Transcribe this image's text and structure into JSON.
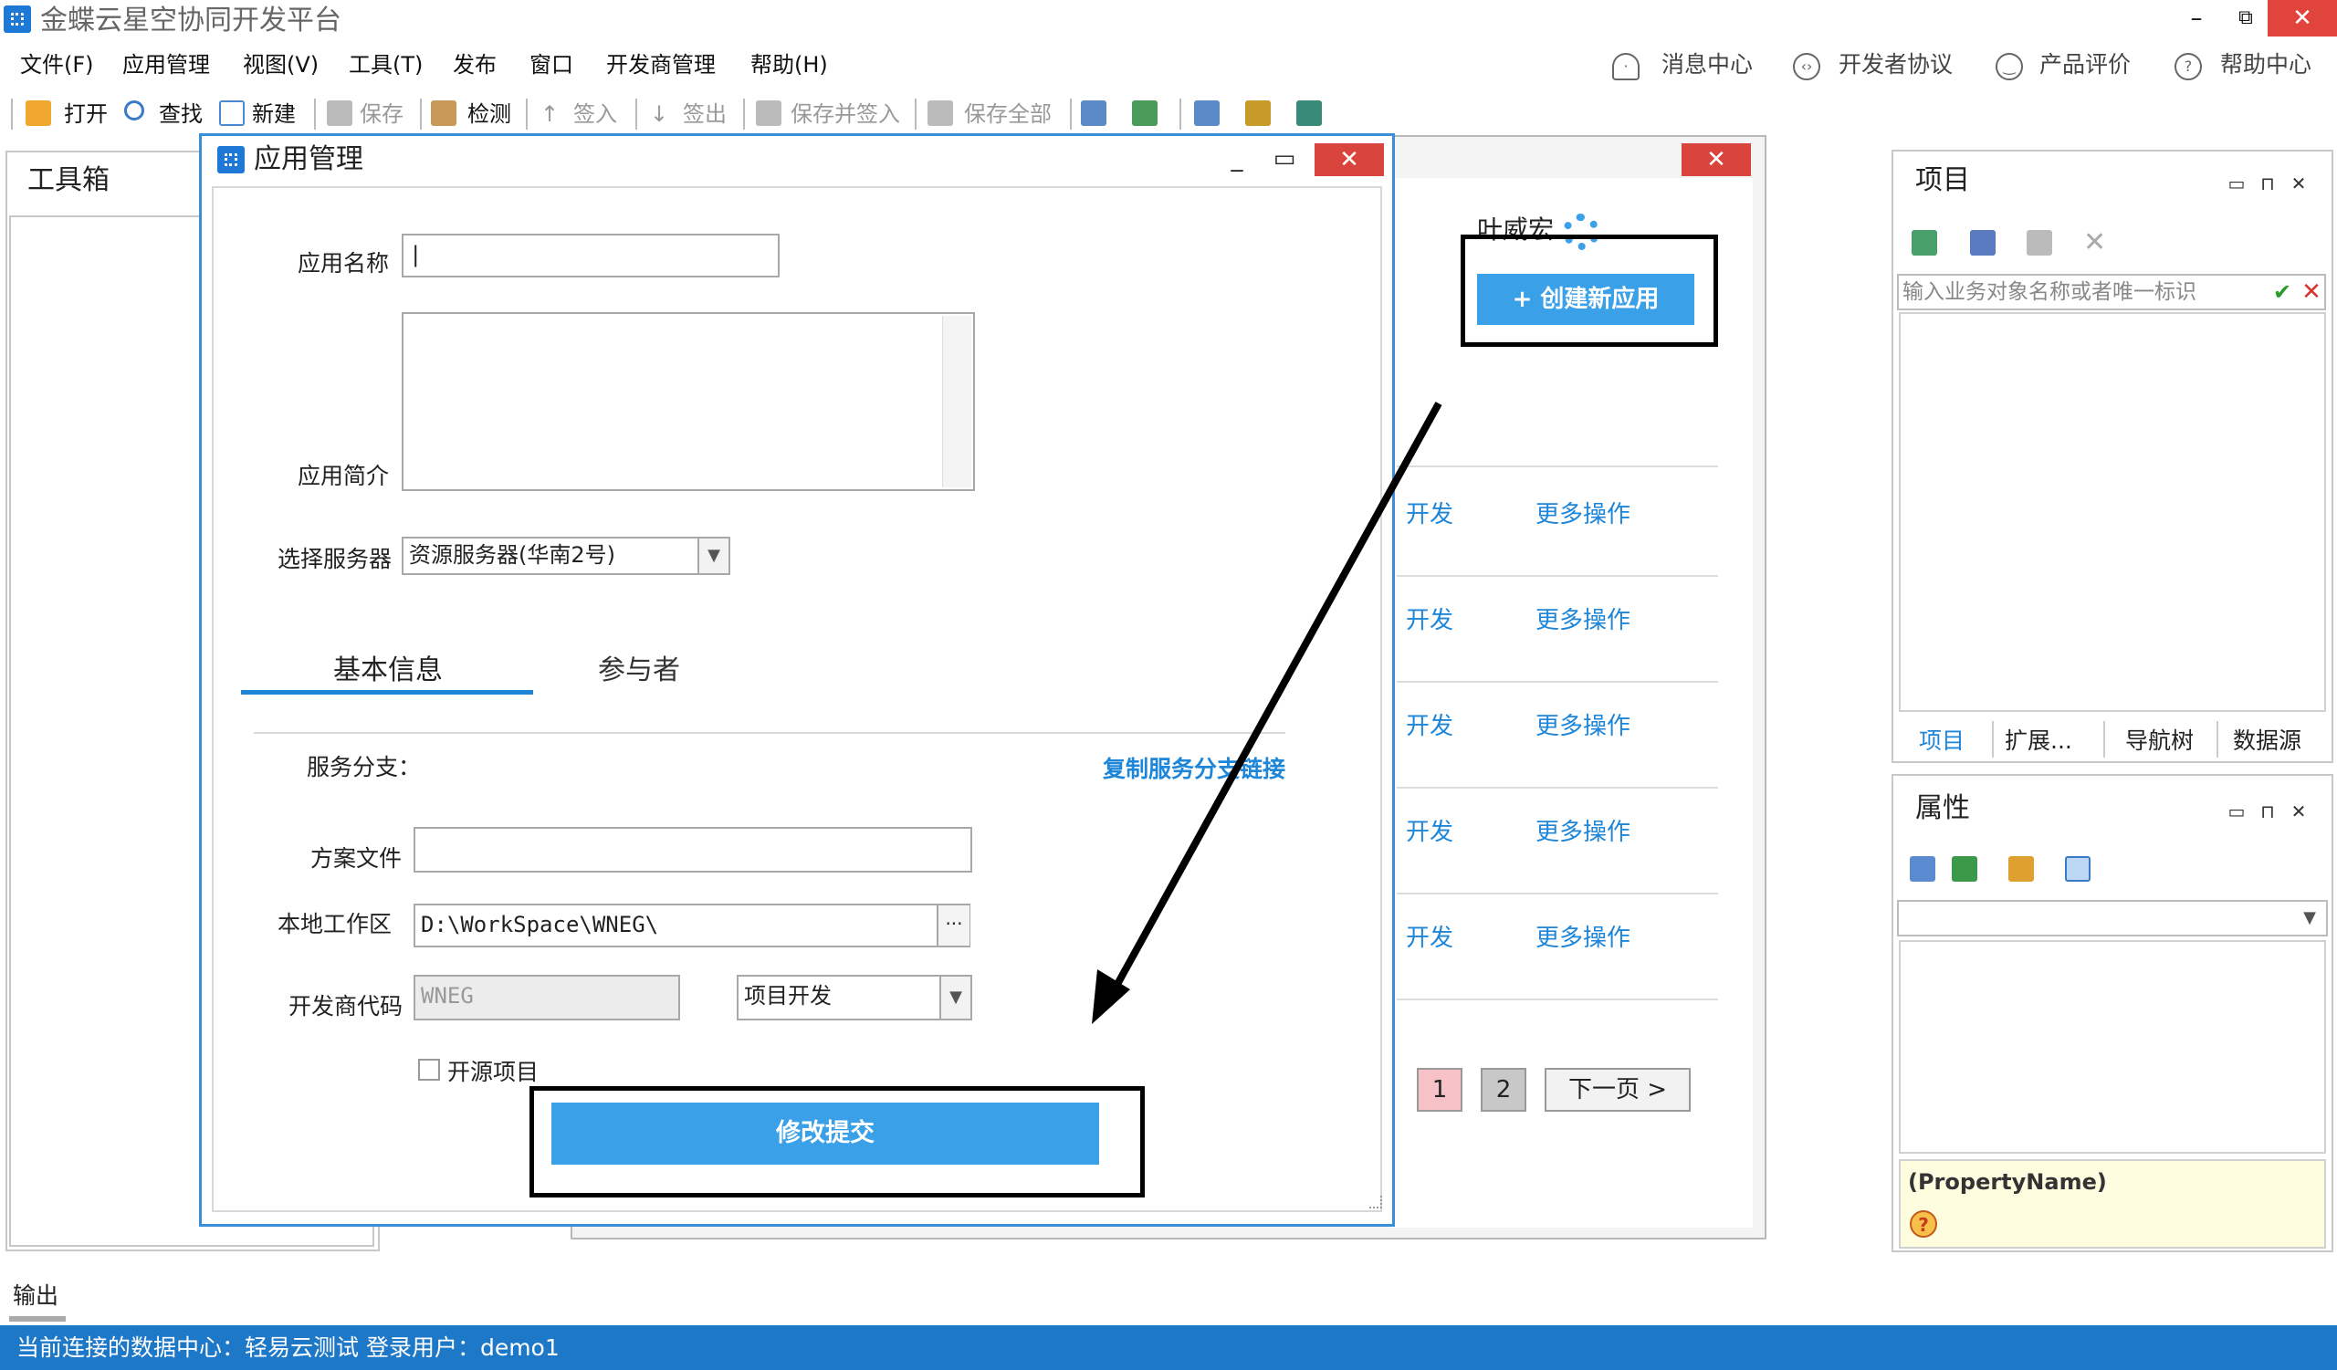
{
  "window": {
    "title": "金蝶云星空协同开发平台",
    "min": "–",
    "max": "⧉",
    "close": "✕"
  },
  "menu": [
    "文件(F)",
    "应用管理",
    "视图(V)",
    "工具(T)",
    "发布",
    "窗口",
    "开发商管理",
    "帮助(H)"
  ],
  "top_right": [
    {
      "icon": "bell-icon",
      "label": "消息中心"
    },
    {
      "icon": "code-icon",
      "label": "开发者协议"
    },
    {
      "icon": "smile-icon",
      "label": "产品评价"
    },
    {
      "icon": "help-icon",
      "label": "帮助中心"
    }
  ],
  "toolbar": {
    "open": "打开",
    "find": "查找",
    "new": "新建",
    "save": "保存",
    "check": "检测",
    "checkin": "签入",
    "checkout": "签出",
    "save_checkin": "保存并签入",
    "save_all": "保存全部"
  },
  "toolbox": {
    "title": "工具箱"
  },
  "background_dialog": {
    "close": "✕",
    "user_name": "叶威宏",
    "create_button": "+ 创建新应用",
    "rows": [
      {
        "dev": "开发",
        "more": "更多操作"
      },
      {
        "dev": "开发",
        "more": "更多操作"
      },
      {
        "dev": "开发",
        "more": "更多操作"
      },
      {
        "dev": "开发",
        "more": "更多操作"
      },
      {
        "dev": "开发",
        "more": "更多操作"
      }
    ],
    "pagination": {
      "page1": "1",
      "page2": "2",
      "next": "下一页 >"
    }
  },
  "dialog": {
    "title": "应用管理",
    "min": "_",
    "max": "▭",
    "close": "✕",
    "app_name_label": "应用名称",
    "app_name_value": "|",
    "app_desc_label": "应用简介",
    "server_label": "选择服务器",
    "server_value": "资源服务器(华南2号)",
    "tabs": {
      "basic": "基本信息",
      "participants": "参与者"
    },
    "branch_label": "服务分支：",
    "copy_link": "复制服务分支链接",
    "plan_file_label": "方案文件",
    "plan_file_value": "",
    "workspace_label": "本地工作区",
    "workspace_value": "D:\\WorkSpace\\WNEG\\",
    "workspace_browse": "···",
    "dev_code_label": "开发商代码",
    "dev_code_value": "WNEG",
    "project_type_value": "项目开发",
    "open_source_label": "开源项目",
    "submit_button": "修改提交"
  },
  "project_panel": {
    "title": "项目",
    "search_placeholder": "输入业务对象名称或者唯一标识",
    "ok": "✔",
    "cancel": "✕",
    "tabs": [
      "项目",
      "扩展...",
      "导航树",
      "数据源"
    ],
    "pin": "⊓",
    "float": "▭",
    "close": "✕"
  },
  "property_panel": {
    "title": "属性",
    "property_name": "(PropertyName)",
    "help": "?",
    "pin": "⊓",
    "float": "▭",
    "close": "✕"
  },
  "output": {
    "label": "输出"
  },
  "status": {
    "text": "当前连接的数据中心：轻易云测试   登录用户：demo1"
  },
  "colors": {
    "accent": "#3aa0e8",
    "status_bar": "#1e78c8",
    "close_red": "#d9453d",
    "link_blue": "#1e86d8"
  }
}
